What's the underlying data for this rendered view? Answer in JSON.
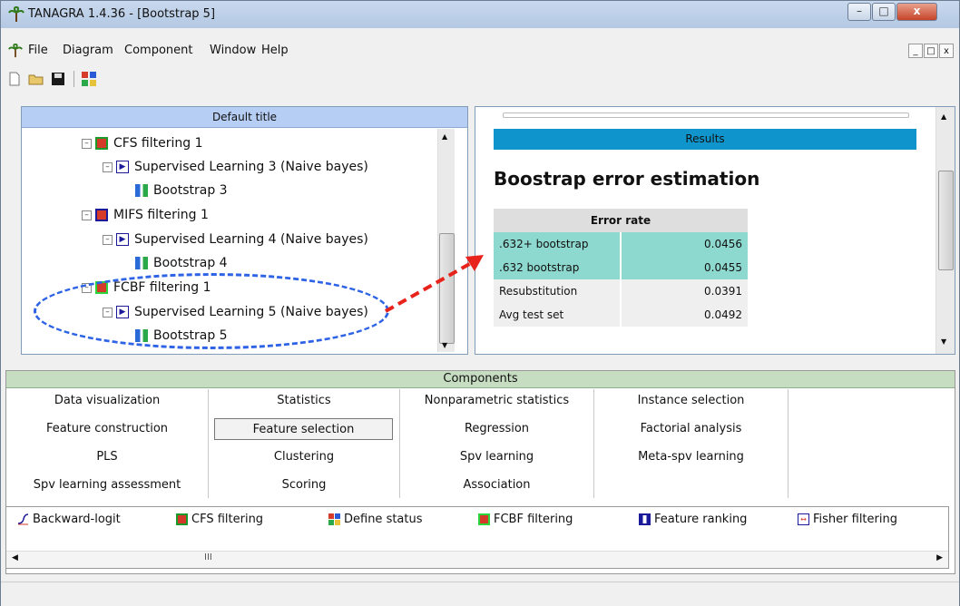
{
  "window": {
    "title": "TANAGRA 1.4.36 - [Bootstrap 5]"
  },
  "menu": {
    "items": [
      "File",
      "Diagram",
      "Component",
      "Window",
      "Help"
    ]
  },
  "toolbar": {
    "icons": [
      "new-file-icon",
      "open-folder-icon",
      "save-icon",
      "define-status-icon"
    ]
  },
  "diagram": {
    "header": "Default title",
    "nodes": [
      {
        "label": "CFS filtering 1",
        "icon": "cfs-filtering-icon"
      },
      {
        "label": "Supervised Learning 3 (Naive bayes)",
        "icon": "supervised-learning-icon"
      },
      {
        "label": "Bootstrap 3",
        "icon": "bootstrap-icon"
      },
      {
        "label": "MIFS filtering 1",
        "icon": "mifs-filtering-icon"
      },
      {
        "label": "Supervised Learning 4 (Naive bayes)",
        "icon": "supervised-learning-icon"
      },
      {
        "label": "Bootstrap 4",
        "icon": "bootstrap-icon"
      },
      {
        "label": "FCBF filtering 1",
        "icon": "fcbf-filtering-icon"
      },
      {
        "label": "Supervised Learning 5 (Naive bayes)",
        "icon": "supervised-learning-icon"
      },
      {
        "label": "Bootstrap 5",
        "icon": "bootstrap-icon"
      }
    ]
  },
  "results": {
    "bar_label": "Results",
    "heading": "Boostrap error estimation",
    "table_header": "Error rate",
    "rows": [
      {
        "label": ".632+ bootstrap",
        "value": "0.0456"
      },
      {
        "label": ".632 bootstrap",
        "value": "0.0455"
      },
      {
        "label": "Resubstitution",
        "value": "0.0391"
      },
      {
        "label": "Avg test set",
        "value": "0.0492"
      }
    ]
  },
  "components": {
    "header": "Components",
    "categories": [
      "Data visualization",
      "Statistics",
      "Nonparametric statistics",
      "Instance selection",
      "Feature construction",
      "Feature selection",
      "Regression",
      "Factorial analysis",
      "PLS",
      "Clustering",
      "Spv learning",
      "Meta-spv learning",
      "Spv learning assessment",
      "Scoring",
      "Association"
    ],
    "selected": "Feature selection",
    "items": [
      {
        "label": "Backward-logit",
        "icon": "backward-logit-icon"
      },
      {
        "label": "CFS filtering",
        "icon": "cfs-filtering-icon"
      },
      {
        "label": "Define status",
        "icon": "define-status-icon"
      },
      {
        "label": "FCBF filtering",
        "icon": "fcbf-filtering-icon"
      },
      {
        "label": "Feature ranking",
        "icon": "feature-ranking-icon"
      },
      {
        "label": "Fisher filtering",
        "icon": "fisher-filtering-icon"
      }
    ],
    "scroll_thumb_glyph": "III"
  },
  "colors": {
    "results_bar": "#0f95cc",
    "row_highlight": "#8ed9cf",
    "diagram_header": "#b6cdf4",
    "components_header": "#c6ddc2",
    "annotation_arrow": "#e8231c",
    "annotation_ellipse": "#2e63e6"
  }
}
